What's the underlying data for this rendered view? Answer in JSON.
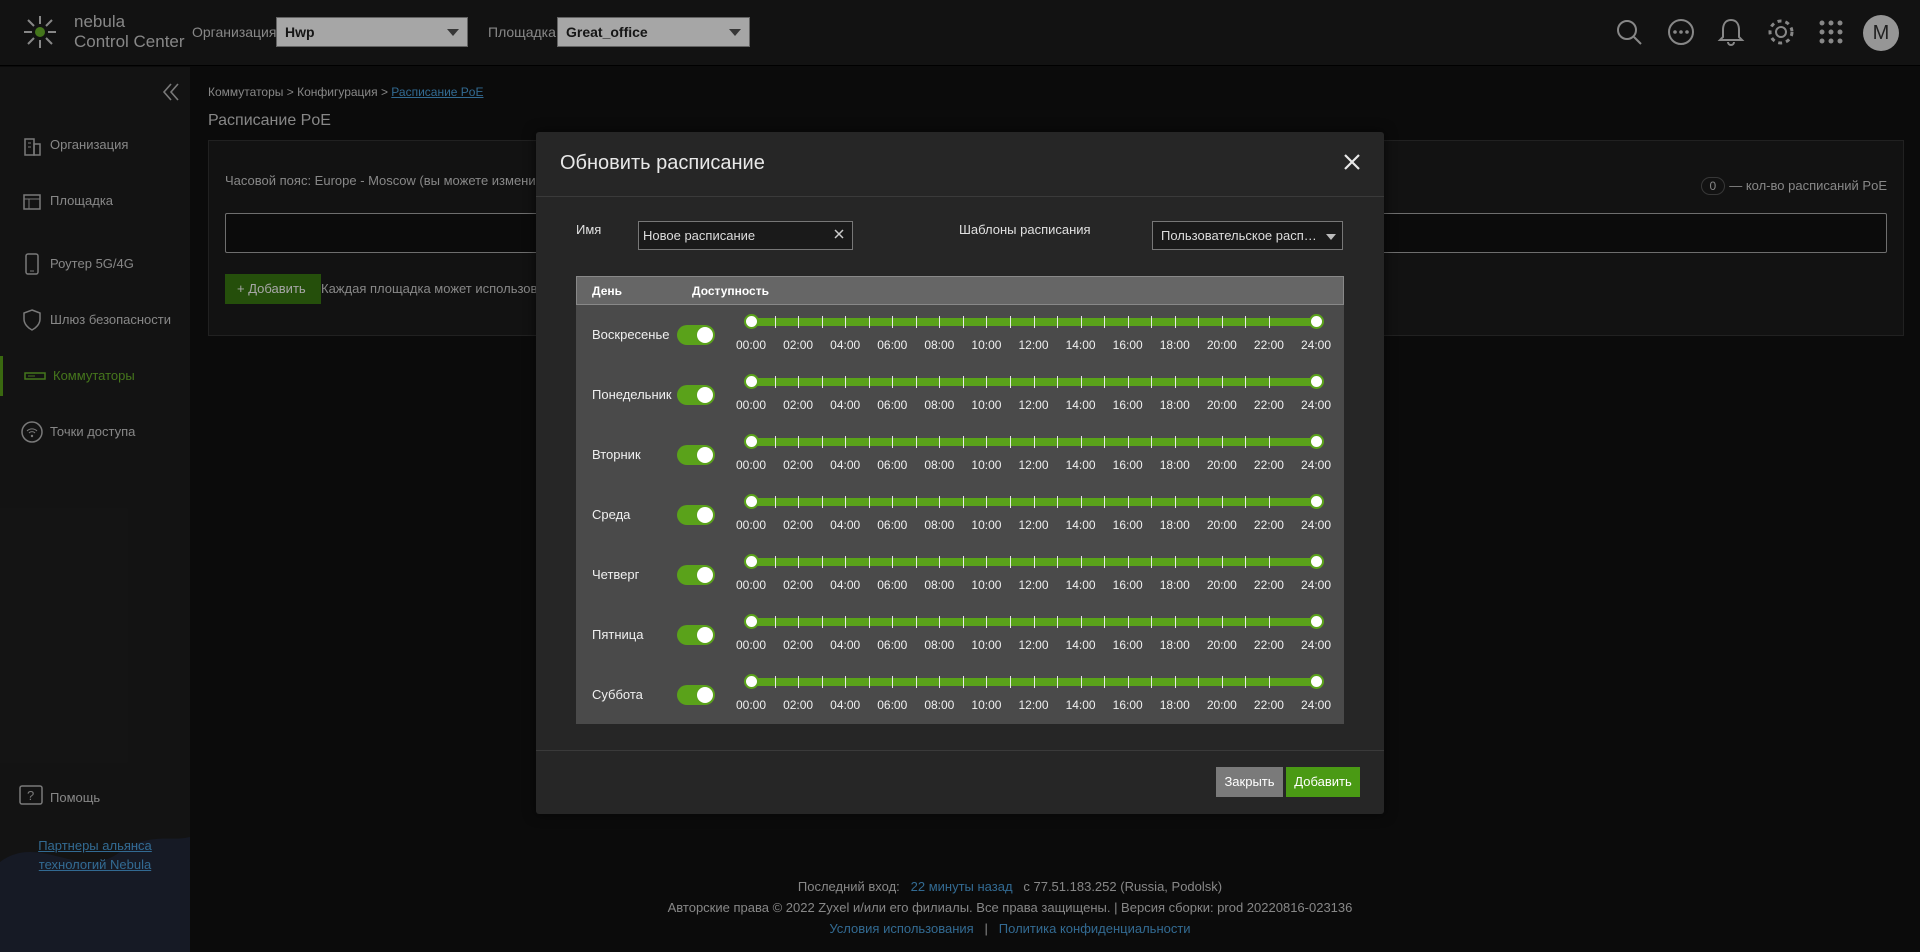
{
  "header": {
    "brand_line1": "nebula",
    "brand_line2": "Control Center",
    "org_label": "Организация:",
    "org_value": "Hwp",
    "site_label": "Площадка:",
    "site_value": "Great_office",
    "avatar_letter": "M"
  },
  "sidebar": {
    "items": [
      {
        "label": "Организация",
        "icon": "building-icon"
      },
      {
        "label": "Площадка",
        "icon": "site-icon"
      },
      {
        "label": "Роутер 5G/4G",
        "icon": "phone-router-icon"
      },
      {
        "label": "Шлюз безопасности",
        "icon": "shield-icon"
      },
      {
        "label": "Коммутаторы",
        "icon": "switch-icon",
        "active": true
      },
      {
        "label": "Точки доступа",
        "icon": "wifi-icon"
      }
    ],
    "help": "Помощь",
    "partners_line1": "Партнеры альянса",
    "partners_line2": "технологий Nebula"
  },
  "breadcrumb": {
    "part1": "Коммутаторы > Конфигурация > ",
    "current": "Расписание PoE"
  },
  "page": {
    "title": "Расписание PoE",
    "timezone_text": "Часовой пояс: Europe - Moscow (вы можете измени",
    "count_value": "0",
    "count_label": "— кол-во расписаний PoE",
    "add_button": "Добавить",
    "add_note": "Каждая площадка может использов"
  },
  "modal": {
    "title": "Обновить расписание",
    "name_label": "Имя",
    "name_value": "Новое расписание",
    "template_label": "Шаблоны расписания",
    "template_value": "Пользовательское расписание",
    "col_day": "День",
    "col_availability": "Доступность",
    "time_labels": [
      "00:00",
      "02:00",
      "04:00",
      "06:00",
      "08:00",
      "10:00",
      "12:00",
      "14:00",
      "16:00",
      "18:00",
      "20:00",
      "22:00",
      "24:00"
    ],
    "days": [
      {
        "name": "Воскресенье",
        "enabled": true,
        "start": "00:00",
        "end": "24:00"
      },
      {
        "name": "Понедельник",
        "enabled": true,
        "start": "00:00",
        "end": "24:00"
      },
      {
        "name": "Вторник",
        "enabled": true,
        "start": "00:00",
        "end": "24:00"
      },
      {
        "name": "Среда",
        "enabled": true,
        "start": "00:00",
        "end": "24:00"
      },
      {
        "name": "Четверг",
        "enabled": true,
        "start": "00:00",
        "end": "24:00"
      },
      {
        "name": "Пятница",
        "enabled": true,
        "start": "00:00",
        "end": "24:00"
      },
      {
        "name": "Суббота",
        "enabled": true,
        "start": "00:00",
        "end": "24:00"
      }
    ],
    "close_button": "Закрыть",
    "add_button": "Добавить"
  },
  "footer": {
    "last_login_label": "Последний вход:",
    "last_login_time": "22 минуты назад",
    "last_login_ip": "с 77.51.183.252 (Russia, Podolsk)",
    "copyright": "Авторские права © 2022 Zyxel и/или его филиалы. Все права защищены. | Версия сборки: prod 20220816-023136",
    "terms": "Условия использования",
    "separator": "|",
    "privacy": "Политика конфиденциальности"
  },
  "colors": {
    "accent": "#5aa21a",
    "link": "#4ea4e0"
  }
}
